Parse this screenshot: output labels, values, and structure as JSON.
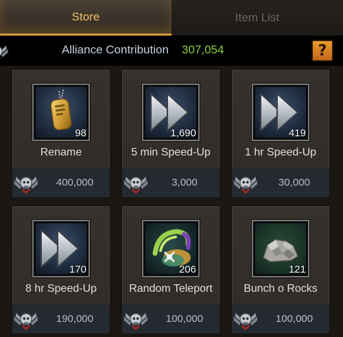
{
  "tabs": {
    "store": "Store",
    "item_list": "Item List"
  },
  "contribution": {
    "label": "Alliance Contribution",
    "value": "307,054",
    "help": "?"
  },
  "items": [
    {
      "name": "Rename",
      "qty": "98",
      "price": "400,000",
      "icon": "dog-tag-icon"
    },
    {
      "name": "5 min Speed-Up",
      "qty": "1,690",
      "price": "3,000",
      "icon": "speed-up-icon"
    },
    {
      "name": "1 hr Speed-Up",
      "qty": "419",
      "price": "30,000",
      "icon": "speed-up-icon"
    },
    {
      "name": "8 hr Speed-Up",
      "qty": "170",
      "price": "190,000",
      "icon": "speed-up-icon"
    },
    {
      "name": "Random Teleport",
      "qty": "206",
      "price": "100,000",
      "icon": "teleport-icon"
    },
    {
      "name": "Bunch o Rocks",
      "qty": "121",
      "price": "100,000",
      "icon": "rocks-icon"
    }
  ],
  "colors": {
    "accent": "#f0c36a",
    "contribution_value": "#8fd23f",
    "help_button": "#e99a2b"
  }
}
